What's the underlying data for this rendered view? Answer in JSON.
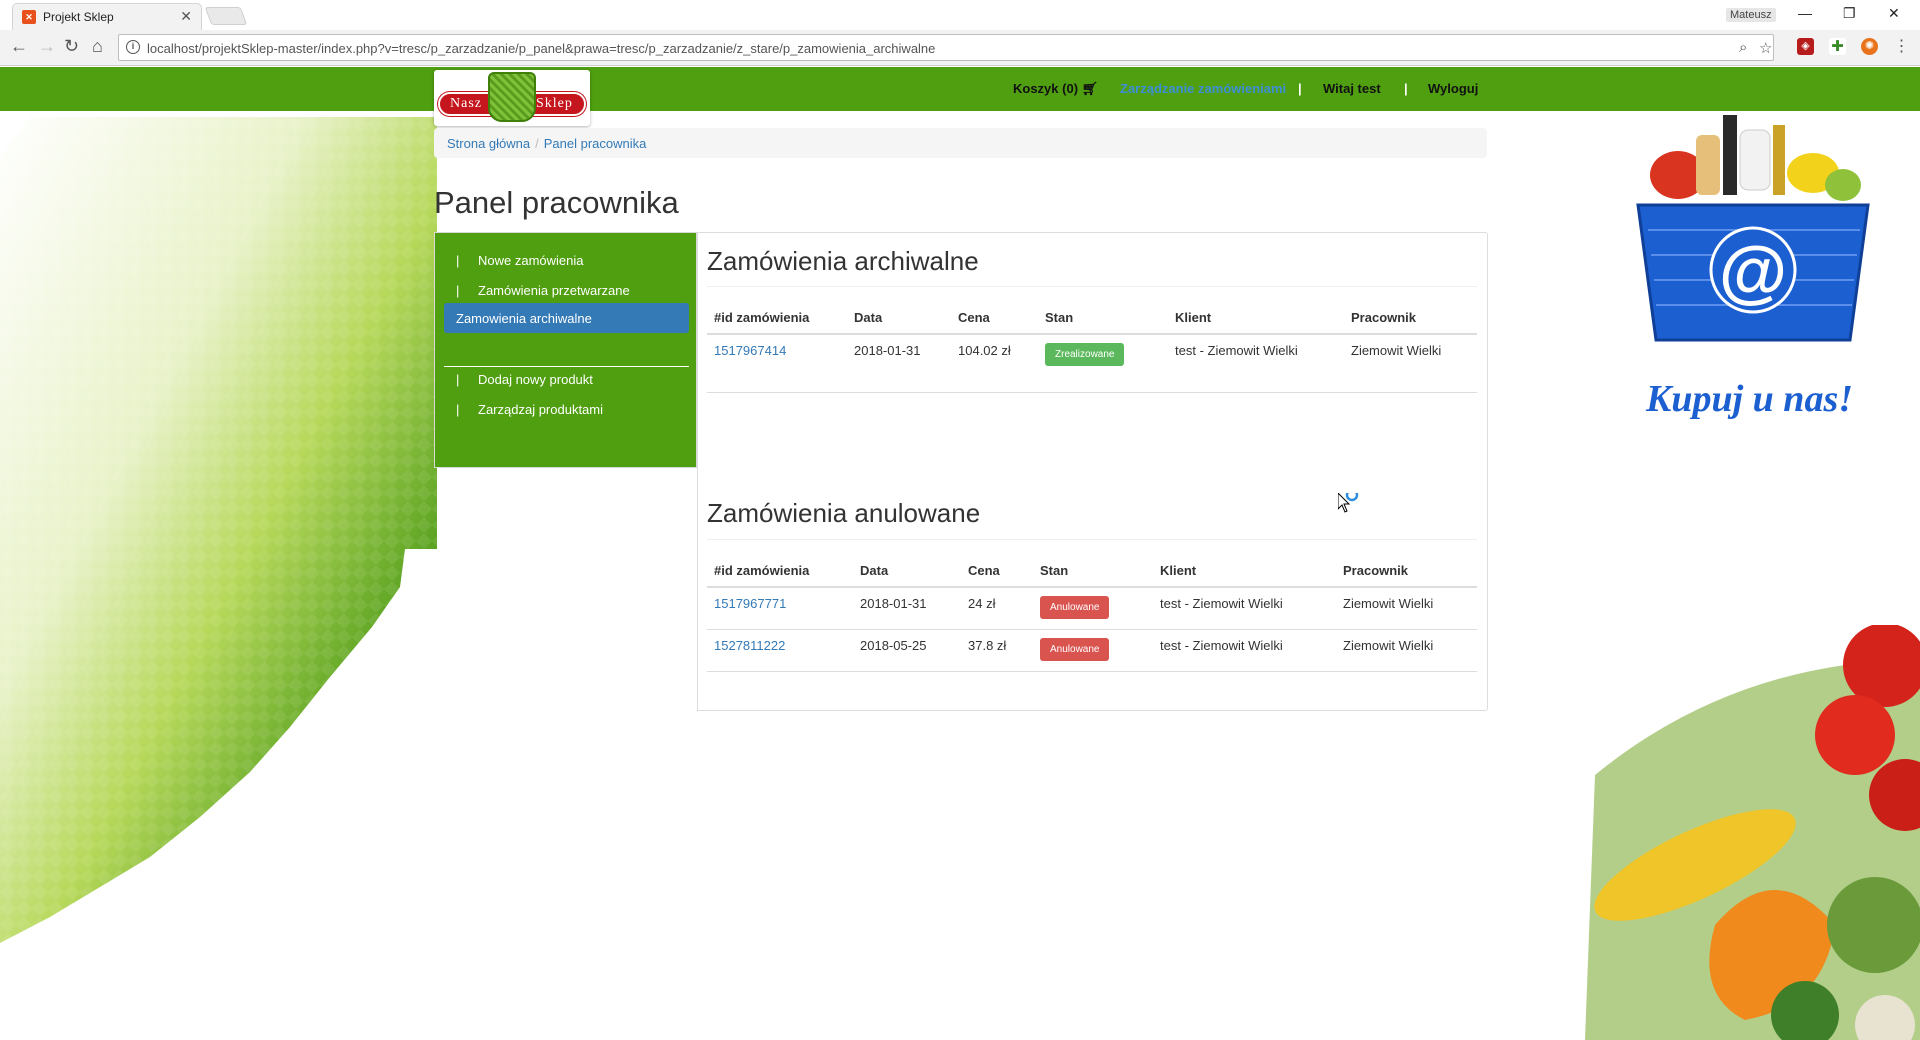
{
  "browser": {
    "tab_title": "Projekt Sklep",
    "tab_favicon": "xampp-icon",
    "profile_name": "Mateusz",
    "url": "localhost/projektSklep-master/index.php?v=tresc/p_zarzadzanie/p_panel&prawa=tresc/p_zarzadzanie/z_stare/p_zamowienia_archiwalne"
  },
  "site": {
    "logo_left": "Nasz",
    "logo_right": "Sklep",
    "nav": {
      "cart": "Koszyk (0)",
      "manage": "Zarządzanie zamówieniami",
      "sep1": "|",
      "welcome": "Witaj test",
      "sep2": "|",
      "logout": "Wyloguj"
    },
    "breadcrumb": [
      "Strona główna",
      "Panel pracownika"
    ],
    "breadcrumb_sep": "/",
    "page_title": "Panel pracownika",
    "sidebar": {
      "items": [
        {
          "bar": "|",
          "label": "Nowe zamówienia"
        },
        {
          "bar": "|",
          "label": "Zamówienia przetwarzane"
        },
        {
          "bar": "",
          "label": "Zamowienia archiwalne"
        },
        {
          "bar": "|",
          "label": "Dodaj nowy produkt"
        },
        {
          "bar": "|",
          "label": "Zarządzaj produktami"
        }
      ]
    },
    "archived": {
      "title": "Zamówienia archiwalne",
      "headers": [
        "#id zamówienia",
        "Data",
        "Cena",
        "Stan",
        "Klient",
        "Pracownik"
      ],
      "rows": [
        {
          "id": "1517967414",
          "date": "2018-01-31",
          "price": "104.02 zł",
          "status": "Zrealizowane",
          "client": "test - Ziemowit Wielki",
          "employee": "Ziemowit Wielki"
        }
      ]
    },
    "cancelled": {
      "title": "Zamówienia anulowane",
      "headers": [
        "#id zamówienia",
        "Data",
        "Cena",
        "Stan",
        "Klient",
        "Pracownik"
      ],
      "rows": [
        {
          "id": "1517967771",
          "date": "2018-01-31",
          "price": "24 zł",
          "status": "Anulowane",
          "client": "test - Ziemowit Wielki",
          "employee": "Ziemowit Wielki"
        },
        {
          "id": "1527811222",
          "date": "2018-05-25",
          "price": "37.8 zł",
          "status": "Anulowane",
          "client": "test - Ziemowit Wielki",
          "employee": "Ziemowit Wielki"
        }
      ]
    },
    "slogan": "Kupuj u nas!"
  },
  "colors": {
    "brand_green": "#4f9f10",
    "link_blue": "#337ab7",
    "success": "#5cb85c",
    "danger": "#d9534f"
  }
}
